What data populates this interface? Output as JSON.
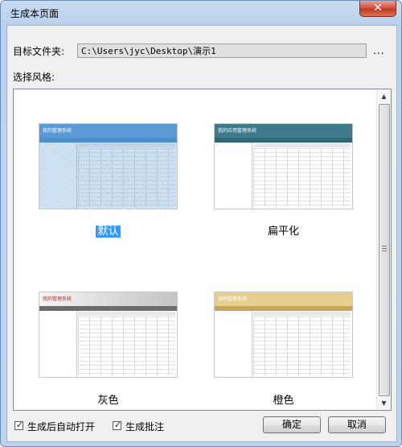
{
  "window": {
    "title": "生成本页面",
    "close_label": "✕"
  },
  "target_folder": {
    "label": "目标文件夹:",
    "value": "C:\\Users\\jyc\\Desktop\\演示1",
    "browse_label": "..."
  },
  "style_section": {
    "label": "选择风格:",
    "styles": [
      {
        "name": "默认",
        "selected": true,
        "app_title": "我的管理系统",
        "header_color": "#5b9bd5",
        "nav_color": "#4f8fd0"
      },
      {
        "name": "扁平化",
        "selected": false,
        "app_title": "我的应用管理系统",
        "header_color": "#3d7a8c",
        "nav_color": "#2f6678"
      },
      {
        "name": "灰色",
        "selected": false,
        "app_title": "我的管理系统",
        "header_color": "#bcbcbc",
        "nav_color": "#6b6b6b"
      },
      {
        "name": "橙色",
        "selected": false,
        "app_title": "我的管理系统",
        "header_color": "#e6cf8e",
        "nav_color": "#c7a65c"
      }
    ]
  },
  "options": {
    "auto_open": {
      "label": "生成后自动打开",
      "checked": true
    },
    "annotate": {
      "label": "生成批注",
      "checked": true
    }
  },
  "buttons": {
    "ok": "确定",
    "cancel": "取消"
  }
}
